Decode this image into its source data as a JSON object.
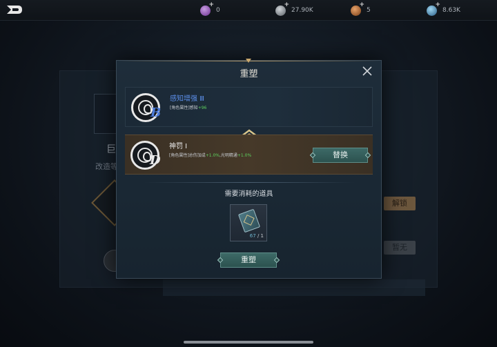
{
  "background": {
    "card_title": "巨",
    "card_subtitle": "改造等",
    "unlock_label": "解锁",
    "locked_label": "暂无"
  },
  "top_bar": {
    "resources": [
      {
        "icon": "purple-gem-icon",
        "value": "0",
        "color": "#8a4fb0"
      },
      {
        "icon": "silver-coin-icon",
        "value": "27.90K",
        "color": "#8c9399"
      },
      {
        "icon": "bronze-medal-icon",
        "value": "5",
        "color": "#b06a3a"
      },
      {
        "icon": "blue-orb-icon",
        "value": "8.63K",
        "color": "#4a8fb8"
      }
    ]
  },
  "modal": {
    "title": "重塑",
    "current_skill": {
      "name": "感知增强 Ⅲ",
      "grade": "B",
      "desc_prefix": "[角色属性]感知",
      "desc_bonus": "+96"
    },
    "new_skill": {
      "name": "神罚 I",
      "grade": "D",
      "desc_prefix": "[角色属性]总伤加成",
      "desc_bonus1": "+1.0%",
      "desc_mid": ",光明精通",
      "desc_bonus2": "+1.0%"
    },
    "replace_label": "替换",
    "required_label": "需要消耗的道具",
    "item": {
      "owned": "67",
      "separator": " / ",
      "needed": "1",
      "icon": "skill-book-icon"
    },
    "reforge_label": "重塑"
  },
  "colors": {
    "accent": "#c9a86e",
    "button": "#2c524f",
    "grade_b": "#4c7bd9"
  }
}
